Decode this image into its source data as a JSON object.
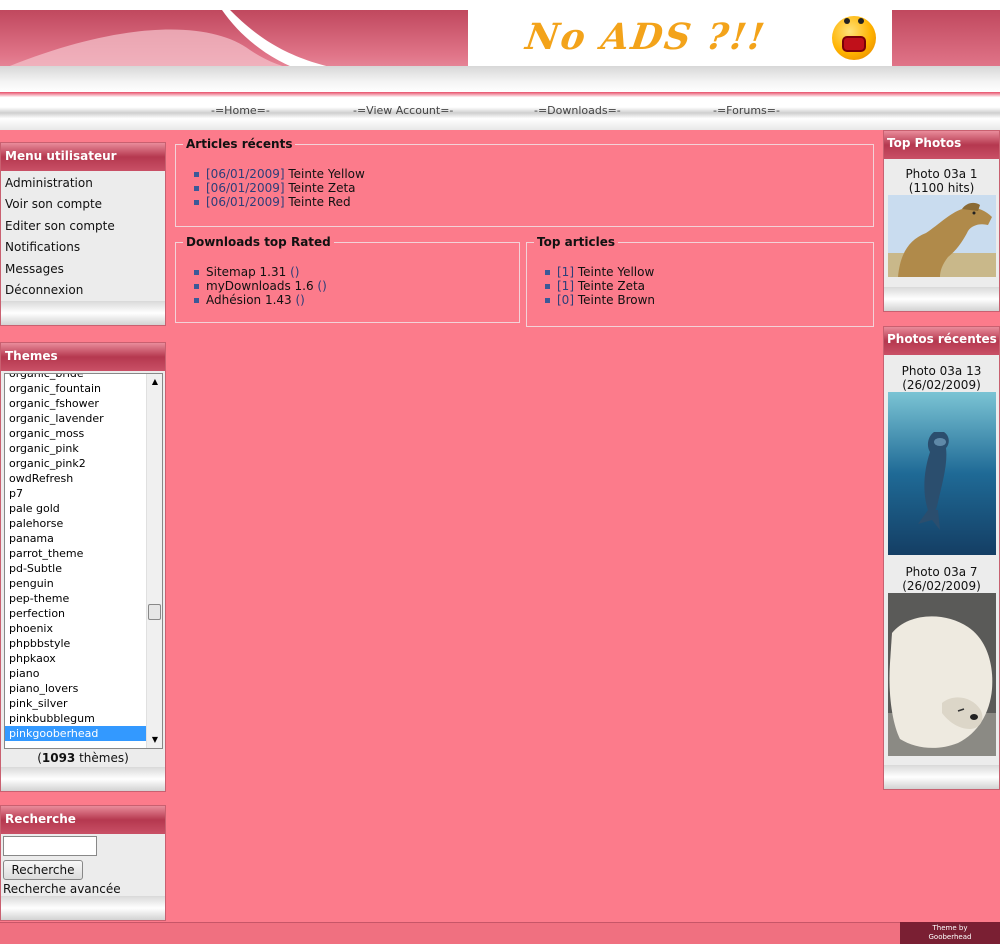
{
  "header": {
    "ad_text": "No ADS ?!!",
    "ad_icon": "screaming-smiley-icon"
  },
  "nav": {
    "items": [
      {
        "label": "-=Home=-"
      },
      {
        "label": "-=View Account=-"
      },
      {
        "label": "-=Downloads=-"
      },
      {
        "label": "-=Forums=-"
      }
    ]
  },
  "user_menu": {
    "title": "Menu utilisateur",
    "items": [
      {
        "label": "Administration"
      },
      {
        "label": "Voir son compte"
      },
      {
        "label": "Editer son compte"
      },
      {
        "label": "Notifications"
      },
      {
        "label": "Messages"
      },
      {
        "label": "Déconnexion"
      }
    ]
  },
  "themes": {
    "title": "Themes",
    "options": [
      "organic_bride",
      "organic_fountain",
      "organic_fshower",
      "organic_lavender",
      "organic_moss",
      "organic_pink",
      "organic_pink2",
      "owdRefresh",
      "p7",
      "pale gold",
      "palehorse",
      "panama",
      "parrot_theme",
      "pd-Subtle",
      "penguin",
      "pep-theme",
      "perfection",
      "phoenix",
      "phpbbstyle",
      "phpkaox",
      "piano",
      "piano_lovers",
      "pink_silver",
      "pinkbubblegum",
      "pinkgooberhead"
    ],
    "selected": "pinkgooberhead",
    "count_prefix": "(",
    "count": "1093",
    "count_suffix": " thèmes)"
  },
  "search": {
    "title": "Recherche",
    "button_label": "Recherche",
    "advanced_label": "Recherche avancée",
    "value": ""
  },
  "recent_articles": {
    "title": "Articles récents",
    "items": [
      {
        "date": "[06/01/2009]",
        "title": "Teinte Yellow"
      },
      {
        "date": "[06/01/2009]",
        "title": "Teinte Zeta"
      },
      {
        "date": "[06/01/2009]",
        "title": "Teinte Red"
      }
    ]
  },
  "downloads_top": {
    "title": "Downloads top Rated",
    "items": [
      {
        "name": "Sitemap 1.31",
        "rating": "()"
      },
      {
        "name": "myDownloads 1.6",
        "rating": "()"
      },
      {
        "name": "Adhésion 1.43",
        "rating": "()"
      }
    ]
  },
  "top_articles": {
    "title": "Top articles",
    "items": [
      {
        "count": "[1]",
        "title": "Teinte Yellow"
      },
      {
        "count": "[1]",
        "title": "Teinte Zeta"
      },
      {
        "count": "[0]",
        "title": "Teinte Brown"
      }
    ]
  },
  "top_photos": {
    "title": "Top Photos",
    "items": [
      {
        "caption": "Photo 03a 1 (1100 hits)",
        "image": "camel-photo"
      }
    ]
  },
  "recent_photos": {
    "title": "Photos récentes",
    "items": [
      {
        "caption": "Photo 03a 13 (26/02/2009)",
        "image": "dolphin-photo"
      },
      {
        "caption": "Photo 03a 7 (26/02/2009)",
        "image": "polar-bear-photo"
      }
    ]
  },
  "footer": {
    "credit_line1": "Theme by",
    "credit_line2": "Gooberhead"
  },
  "colors": {
    "page_bg": "#fc7b8b",
    "block_header": "#b5384f",
    "link_dim": "#2c3e7a",
    "selected_option": "#3399ff"
  }
}
